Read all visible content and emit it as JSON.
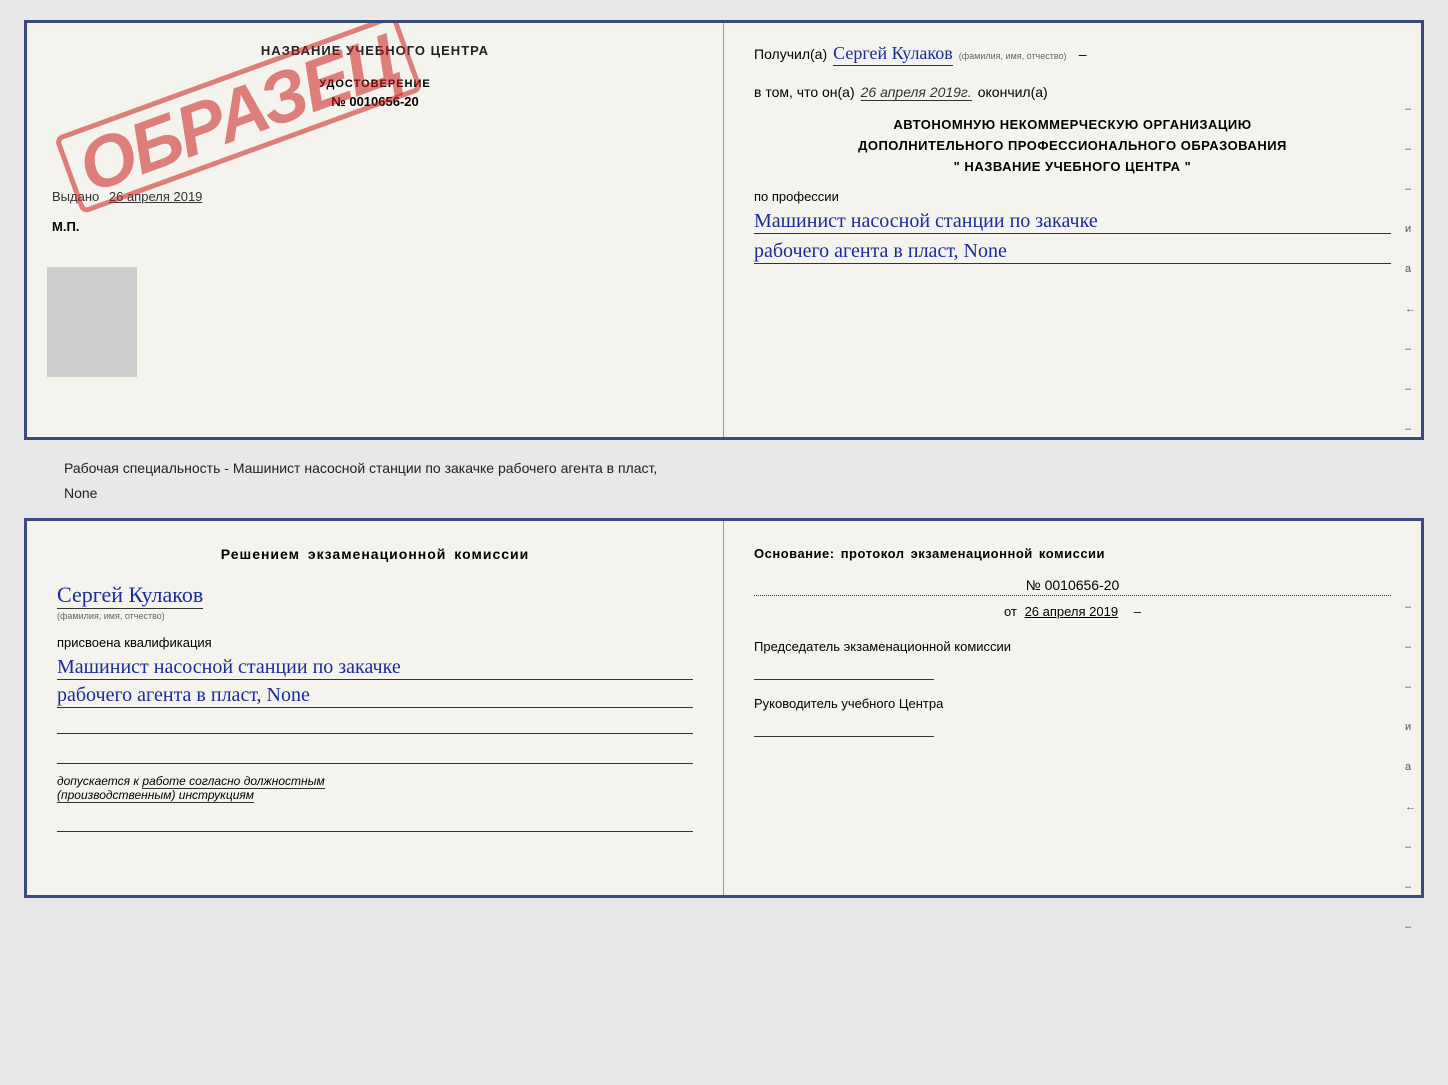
{
  "document_top": {
    "left": {
      "school_name": "НАЗВАНИЕ УЧЕБНОГО ЦЕНТРА",
      "stamp_text": "ОБРАЗЕЦ",
      "cert_label": "УДОСТОВЕРЕНИЕ",
      "cert_number": "№ 0010656-20",
      "issue_prefix": "Выдано",
      "issue_date": "26 апреля 2019",
      "mp_label": "М.П."
    },
    "right": {
      "received_prefix": "Получил(а)",
      "person_name": "Сергей Кулаков",
      "name_subtitle": "(фамилия, имя, отчество)",
      "date_prefix": "в том, что он(а)",
      "date_value": "26 апреля 2019г.",
      "date_suffix": "окончил(а)",
      "org_line1": "АВТОНОМНУЮ НЕКОММЕРЧЕСКУЮ ОРГАНИЗАЦИЮ",
      "org_line2": "ДОПОЛНИТЕЛЬНОГО ПРОФЕССИОНАЛЬНОГО ОБРАЗОВАНИЯ",
      "org_line3": "\" НАЗВАНИЕ УЧЕБНОГО ЦЕНТРА \"",
      "profession_label": "по профессии",
      "profession_line1": "Машинист насосной станции по закачке",
      "profession_line2": "рабочего агента в пласт, None",
      "side_dashes": [
        "–",
        "–",
        "–",
        "и",
        "а",
        "←",
        "–",
        "–",
        "–"
      ]
    }
  },
  "subtitle": {
    "text1": "Рабочая специальность - Машинист насосной станции по закачке рабочего агента в пласт,",
    "text2": "None"
  },
  "document_bottom": {
    "left": {
      "commission_title": "Решением экзаменационной комиссии",
      "person_name": "Сергей Кулаков",
      "name_subtitle": "(фамилия, имя, отчество)",
      "assigned_label": "присвоена квалификация",
      "qual_line1": "Машинист насосной станции по закачке",
      "qual_line2": "рабочего агента в пласт, None",
      "admit_text1": "допускается к",
      "admit_underline": "работе согласно должностным",
      "admit_text2": "(производственным) инструкциям"
    },
    "right": {
      "basis_label": "Основание: протокол экзаменационной комиссии",
      "protocol_number": "№ 0010656-20",
      "protocol_date_prefix": "от",
      "protocol_date": "26 апреля 2019",
      "chairman_label": "Председатель экзаменационной комиссии",
      "director_label": "Руководитель учебного Центра",
      "side_dashes": [
        "–",
        "–",
        "–",
        "и",
        "а",
        "←",
        "–",
        "–",
        "–"
      ]
    }
  }
}
